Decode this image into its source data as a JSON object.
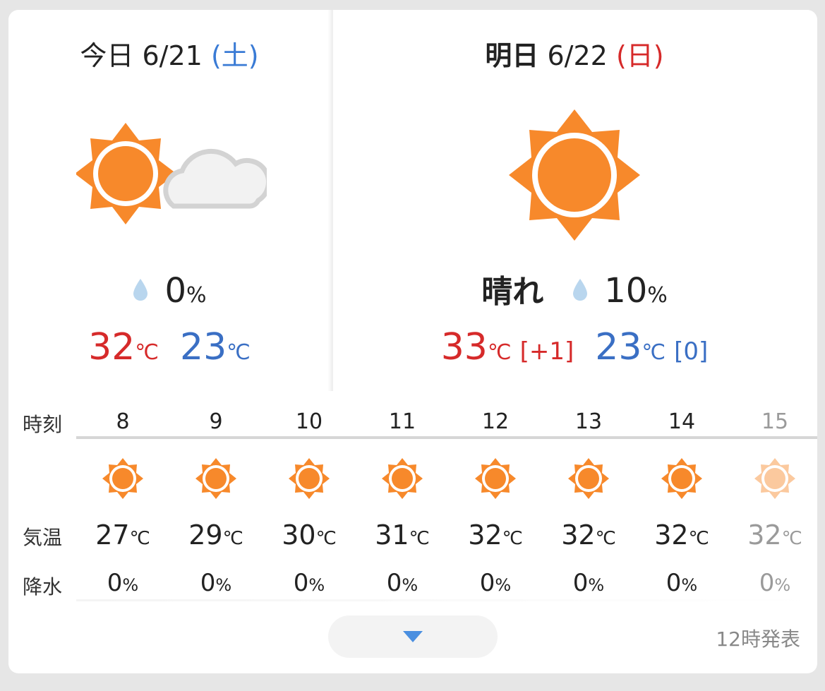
{
  "today": {
    "label": "今日",
    "date": "6/21",
    "dow": "(土)",
    "weather_icon": "sunny-then-cloudy-icon",
    "pop_value": "0",
    "pop_unit": "%",
    "high": "32",
    "low": "23",
    "unit": "℃"
  },
  "tomorrow": {
    "label": "明日",
    "date": "6/22",
    "dow": "(日)",
    "weather_icon": "sunny-icon",
    "weather_text": "晴れ",
    "pop_value": "10",
    "pop_unit": "%",
    "high": "33",
    "high_diff": "[+1]",
    "low": "23",
    "low_diff": "[0]",
    "unit": "℃"
  },
  "hourly": {
    "labels": {
      "time": "時刻",
      "temp": "気温",
      "precip": "降水"
    },
    "unit_temp": "℃",
    "unit_pct": "%",
    "hours": [
      {
        "hour": "8",
        "temp": "27",
        "pop": "0",
        "icon": "sunny-icon"
      },
      {
        "hour": "9",
        "temp": "29",
        "pop": "0",
        "icon": "sunny-icon"
      },
      {
        "hour": "10",
        "temp": "30",
        "pop": "0",
        "icon": "sunny-icon"
      },
      {
        "hour": "11",
        "temp": "31",
        "pop": "0",
        "icon": "sunny-icon"
      },
      {
        "hour": "12",
        "temp": "32",
        "pop": "0",
        "icon": "sunny-icon"
      },
      {
        "hour": "13",
        "temp": "32",
        "pop": "0",
        "icon": "sunny-icon"
      },
      {
        "hour": "14",
        "temp": "32",
        "pop": "0",
        "icon": "sunny-icon"
      },
      {
        "hour": "15",
        "temp": "32",
        "pop": "0",
        "icon": "sunny-icon"
      }
    ]
  },
  "footer": {
    "issued": "12時発表"
  },
  "colors": {
    "sun": "#f7892b",
    "hot": "#d62a2a",
    "cold": "#3a6fc4",
    "accent": "#4a8fe0"
  }
}
